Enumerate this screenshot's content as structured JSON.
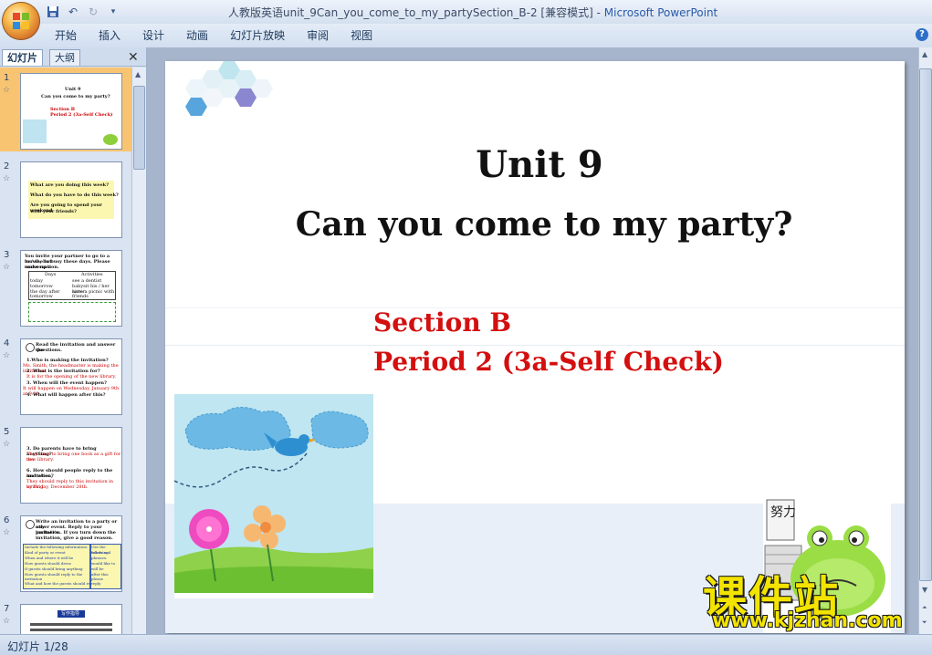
{
  "window": {
    "title_doc": "人教版英语unit_9Can_you_come_to_my_partySection_B-2 [兼容模式] - ",
    "title_app": "Microsoft PowerPoint"
  },
  "ribbon": {
    "tabs": [
      "开始",
      "插入",
      "设计",
      "动画",
      "幻灯片放映",
      "审阅",
      "视图"
    ]
  },
  "panel": {
    "tab_slides": "幻灯片",
    "tab_outline": "大纲",
    "thumbnails": [
      {
        "num": "1",
        "lines": [
          "Unit 9",
          "Can you come to my party?",
          "Section B",
          "Period 2 (3a-Self Check)"
        ]
      },
      {
        "num": "2",
        "lines": [
          "What are you doing this week?",
          "What do you have to do this week?",
          "Are you going to spend your weekend",
          "with your friends?"
        ]
      },
      {
        "num": "3",
        "lines": [
          "You invite your partner to go to a movie, but",
          "he/ she is busy these days. Please make up a",
          "conversation.",
          "Days",
          "Activities",
          "today",
          "see a dentist",
          "tomorrow",
          "babysit his / her sister",
          "the day after",
          "have a picnic with",
          "tomorrow",
          "friends"
        ]
      },
      {
        "num": "4",
        "lines": [
          "Read the invitation and answer the",
          "questions.",
          "1.Who is making the invitation?",
          "Ms. Smith, the headmaster is making the invitation.",
          "2. What is the invitation for?",
          "It is for the opening of the new library.",
          "3. When will the event happen?",
          "It will happen on Wednesday, January 9th at 9:00",
          "4. What will happen after this?"
        ]
      },
      {
        "num": "5",
        "lines": [
          "3. Do parents have to bring anything?",
          "They have to bring one book as a gift for the",
          "new library.",
          "6. How should people reply to the invitation,",
          "and when?",
          "They should reply to this invitation in writing",
          "by Friday, December 28th."
        ]
      },
      {
        "num": "6",
        "lines": [
          "Write an invitation to a party or any",
          "other event. Reply to your partner's",
          "invitation. If you turn down the",
          "invitation, give a good reason.",
          "Include the following information:",
          "Kind of party or event",
          "When and where it will be",
          "How guests should dress",
          "If guests should bring anything",
          "How guests should reply to the",
          "invitation",
          "What and how the guests should reply",
          "Use the following",
          "words and",
          "phrases:",
          "would like to",
          "will be",
          "after this",
          "please",
          "reply"
        ]
      },
      {
        "num": "7",
        "lines": [
          "写作指导"
        ]
      }
    ]
  },
  "slide": {
    "title_line1": "Unit 9",
    "title_line2": "Can you come to my party?",
    "section_line1": "Section B",
    "section_line2": "Period 2 (3a-Self Check)",
    "frog_sign": "努力"
  },
  "status": {
    "slide_counter": "幻灯片 1/28"
  },
  "watermark": {
    "chinese": "课件站",
    "url": "www.kjzhan.com"
  }
}
